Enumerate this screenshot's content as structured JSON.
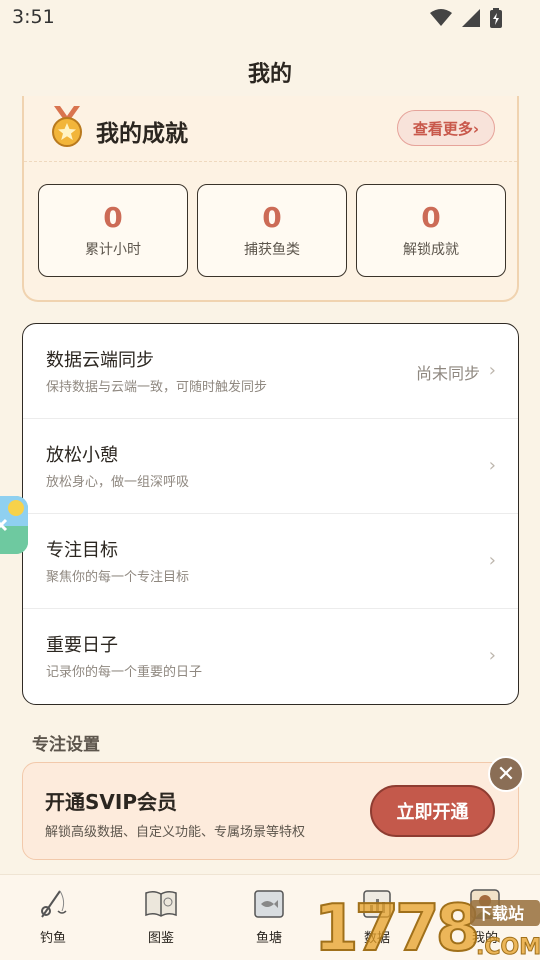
{
  "status": {
    "time": "3:51"
  },
  "header": {
    "title": "我的"
  },
  "achievements": {
    "title": "我的成就",
    "more_label": "查看更多›",
    "stats": [
      {
        "value": "0",
        "label": "累计小时"
      },
      {
        "value": "0",
        "label": "捕获鱼类"
      },
      {
        "value": "0",
        "label": "解锁成就"
      }
    ]
  },
  "settings": {
    "items": [
      {
        "title": "数据云端同步",
        "subtitle": "保持数据与云端一致，可随时触发同步",
        "value": "尚未同步"
      },
      {
        "title": "放松小憩",
        "subtitle": "放松身心，做一组深呼吸",
        "value": ""
      },
      {
        "title": "专注目标",
        "subtitle": "聚焦你的每一个专注目标",
        "value": ""
      },
      {
        "title": "重要日子",
        "subtitle": "记录你的每一个重要的日子",
        "value": ""
      }
    ]
  },
  "focus_section": {
    "title": "专注设置"
  },
  "svip": {
    "title": "开通SVIP会员",
    "subtitle": "解锁高级数据、自定义功能、专属场景等特权",
    "button": "立即开通",
    "close": "✕"
  },
  "nav": {
    "items": [
      {
        "label": "钓鱼",
        "icon": "fishing-rod-icon"
      },
      {
        "label": "图鉴",
        "icon": "book-icon"
      },
      {
        "label": "鱼塘",
        "icon": "fish-pond-icon"
      },
      {
        "label": "数据",
        "icon": "data-icon"
      },
      {
        "label": "我的",
        "icon": "avatar-icon"
      }
    ]
  },
  "watermark": {
    "text": "1778",
    "badge": "下载站",
    "suffix": ".COM"
  },
  "colors": {
    "accent": "#c4594b",
    "background": "#faf3e6",
    "stat_value": "#cc6b56"
  }
}
